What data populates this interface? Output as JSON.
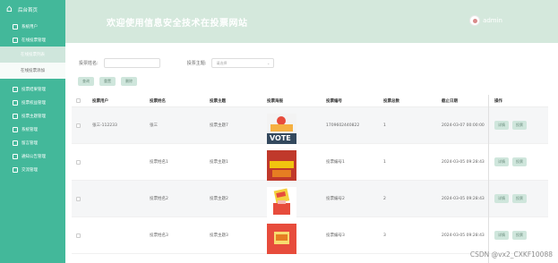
{
  "sidebar": {
    "home": "后台首页",
    "items": [
      {
        "label": "系统用户"
      },
      {
        "label": "在线投票管理"
      },
      {
        "label": "在线投票列表",
        "sub": true,
        "active": true
      },
      {
        "label": "在线投票添加",
        "sub": true,
        "active": false
      },
      {
        "label": "投票结果管理"
      },
      {
        "label": "投票权益管理"
      },
      {
        "label": "投票主题管理"
      },
      {
        "label": "系统管理"
      },
      {
        "label": "留言管理"
      },
      {
        "label": "通知公告管理"
      },
      {
        "label": "交流管理"
      }
    ]
  },
  "header": {
    "title": "欢迎使用信息安全技术在投票网站",
    "username": "admin"
  },
  "search": {
    "name_label": "投票姓名:",
    "topic_label": "投票主题:",
    "topic_placeholder": "请选择"
  },
  "buttons": {
    "search": "查询",
    "reset": "重置",
    "delete": "删除"
  },
  "table": {
    "columns": [
      "投票用户",
      "投票姓名",
      "投票主题",
      "投票海报",
      "投票编号",
      "投票总数",
      "截止日期",
      "操作"
    ],
    "rows": [
      {
        "user": "张三-112233",
        "name": "张三",
        "topic": "投票主题7",
        "poster": "vote",
        "poster_text": "VOTE",
        "code": "1709602440822",
        "total": "1",
        "deadline": "2024-03-07 00:00:00"
      },
      {
        "user": "",
        "name": "投票姓名1",
        "topic": "投票主题1",
        "poster": "red1",
        "poster_text": "",
        "code": "投票编号1",
        "total": "1",
        "deadline": "2024-03-05 09:28:43"
      },
      {
        "user": "",
        "name": "投票姓名2",
        "topic": "投票主题2",
        "poster": "ballot",
        "poster_text": "",
        "code": "投票编号2",
        "total": "2",
        "deadline": "2024-03-05 09:28:43"
      },
      {
        "user": "",
        "name": "投票姓名3",
        "topic": "投票主题3",
        "poster": "red2",
        "poster_text": "",
        "code": "投票编号3",
        "total": "3",
        "deadline": "2024-03-05 09:28:43"
      }
    ],
    "row_actions": [
      "详情",
      "投票"
    ]
  },
  "watermark": "CSDN @vx2_CXKF10088",
  "colors": {
    "sidebar": "#43b89a",
    "header": "#d4e8dc",
    "button": "#cfe6dc"
  }
}
